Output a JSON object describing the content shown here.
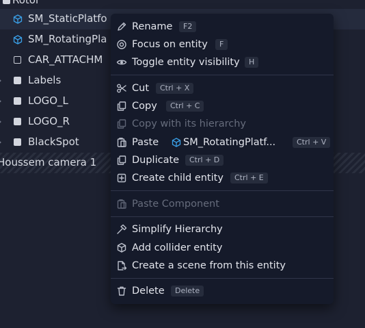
{
  "tree": {
    "top_item": "Rotor",
    "rows": [
      {
        "label": "SM_StaticPlatfo"
      },
      {
        "label": "SM_RotatingPla"
      },
      {
        "label": "CAR_ATTACHM"
      },
      {
        "label": "Labels"
      },
      {
        "label": "LOGO_L"
      },
      {
        "label": "LOGO_R"
      },
      {
        "label": "BlackSpot"
      },
      {
        "label": "Houssem camera 1"
      }
    ]
  },
  "menu": {
    "rename": {
      "label": "Rename",
      "shortcut": "F2"
    },
    "focus": {
      "label": "Focus on entity",
      "shortcut": "F"
    },
    "toggle_visibility": {
      "label": "Toggle entity visibility",
      "shortcut": "H"
    },
    "cut": {
      "label": "Cut",
      "shortcut": "Ctrl + X"
    },
    "copy": {
      "label": "Copy",
      "shortcut": "Ctrl + C"
    },
    "copy_hierarchy": {
      "label": "Copy with its hierarchy"
    },
    "paste": {
      "label": "Paste",
      "entity": "SM_RotatingPlatf...",
      "shortcut": "Ctrl + V"
    },
    "duplicate": {
      "label": "Duplicate",
      "shortcut": "Ctrl + D"
    },
    "create_child": {
      "label": "Create child entity",
      "shortcut": "Ctrl + E"
    },
    "paste_component": {
      "label": "Paste Component"
    },
    "simplify": {
      "label": "Simplify Hierarchy"
    },
    "add_collider": {
      "label": "Add collider entity"
    },
    "create_scene": {
      "label": "Create a scene from this entity"
    },
    "delete": {
      "label": "Delete",
      "shortcut": "Delete"
    }
  },
  "colors": {
    "background": "#1d2130",
    "menu_background": "#151a2a",
    "cube_icon": "#3aa0e8",
    "disabled_text": "#666c7c"
  }
}
